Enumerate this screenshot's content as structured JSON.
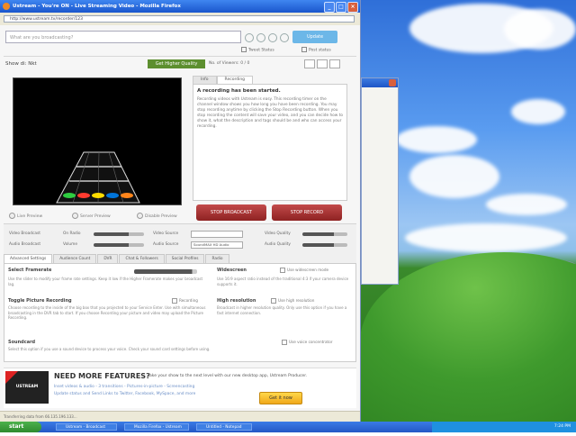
{
  "window": {
    "title": "Ustream - You're ON - Live Streaming Video - Mozilla Firefox",
    "url": "http://www.ustream.tv/recorder/123"
  },
  "window_controls": {
    "minimize": "_",
    "maximize": "□",
    "close": "×"
  },
  "search": {
    "placeholder": "What are you broadcasting?",
    "button": "Update",
    "option1": "Tweet Status",
    "option2": "Post status"
  },
  "broadcast": {
    "show_link": "Show di: Nkt",
    "hq_button": "Get Higher Quality",
    "viewers": "No. of Viewers: 0 / 0"
  },
  "preview": {
    "radio1": "Live Preview",
    "radio2": "Server Preview",
    "radio3": "Disable Preview"
  },
  "info_tabs": [
    "Info",
    "Recording"
  ],
  "recording": {
    "heading": "A recording has been started.",
    "body": "Recording videos with Ustream is easy. This recording timer on the channel window shows you how long you have been recording. You may stop recording anytime by clicking the Stop Recording button. When you stop recording the content will save your video, and you can decide how to show it, what the description and tags should be and who can access your recording."
  },
  "buttons": {
    "stop_broadcast": "STOP BROADCAST",
    "stop_record": "STOP RECORD"
  },
  "controls": {
    "video_broadcast": "Video Broadcast",
    "audio_broadcast": "Audio Broadcast",
    "on_radio": "On Radio",
    "volume": "Volume",
    "video_source": "Video Source",
    "audio_source": "Audio Source",
    "audio_source_value": "SoundMAX HD Audio",
    "video_quality": "Video Quality",
    "audio_quality": "Audio Quality",
    "volume_level": 0.7
  },
  "settings_tabs": [
    "Advanced Settings",
    "Audience Count",
    "DVR",
    "Chat & Followers",
    "Social Profiles",
    "Radio"
  ],
  "settings": {
    "select_framerate": {
      "title": "Select Framerate",
      "desc": "Use the slider to modify your frame rate settings. Keep it low if the Higher Framerate makes your broadcast lag."
    },
    "widescreen": {
      "title": "Widescreen",
      "option": "Use widescreen mode",
      "desc": "Use 16:9 aspect ratio instead of the traditional 4:3 if your camera device supports it."
    },
    "toggle_picture": {
      "title": "Toggle Picture Recording",
      "option": "Recording",
      "desc": "Choose recording to the inside of the big box that you projected to your Service Enter. Use with simultaneous broadcasting in the DVR tab to start. If you choose Recording your picture and video may upload the Picture Recording."
    },
    "high_res": {
      "title": "High resolution",
      "option": "Use high resolution",
      "desc": "Broadcast in higher resolution quality. Only use this option if you have a fast internet connection."
    },
    "soundcard": {
      "title": "Soundcard",
      "option": "Use voice concentrator",
      "desc": "Select this option if you use a sound device to process your voice. Check your sound card settings before using."
    }
  },
  "promo": {
    "logo": "USTREAM PRODUCER",
    "title": "NEED MORE FEATURES?",
    "tail": "Take your show to the next level with our new desktop app, Ustream Producer.",
    "line1": "Inset videos & audio - 3 transitions - Pictures-in-picture - Screencasting",
    "line2": "Update status and Send Links to Twitter, Facebook, MySpace, and more",
    "button": "Get it now"
  },
  "status_bar": "Transferring data from 66.135.196.133...",
  "taskbar": {
    "start": "start",
    "tasks": [
      "Ustream - Broadcast",
      "Mozilla Firefox - Ustream",
      "Untitled - Notepad"
    ],
    "clock": "7:24 PM"
  }
}
